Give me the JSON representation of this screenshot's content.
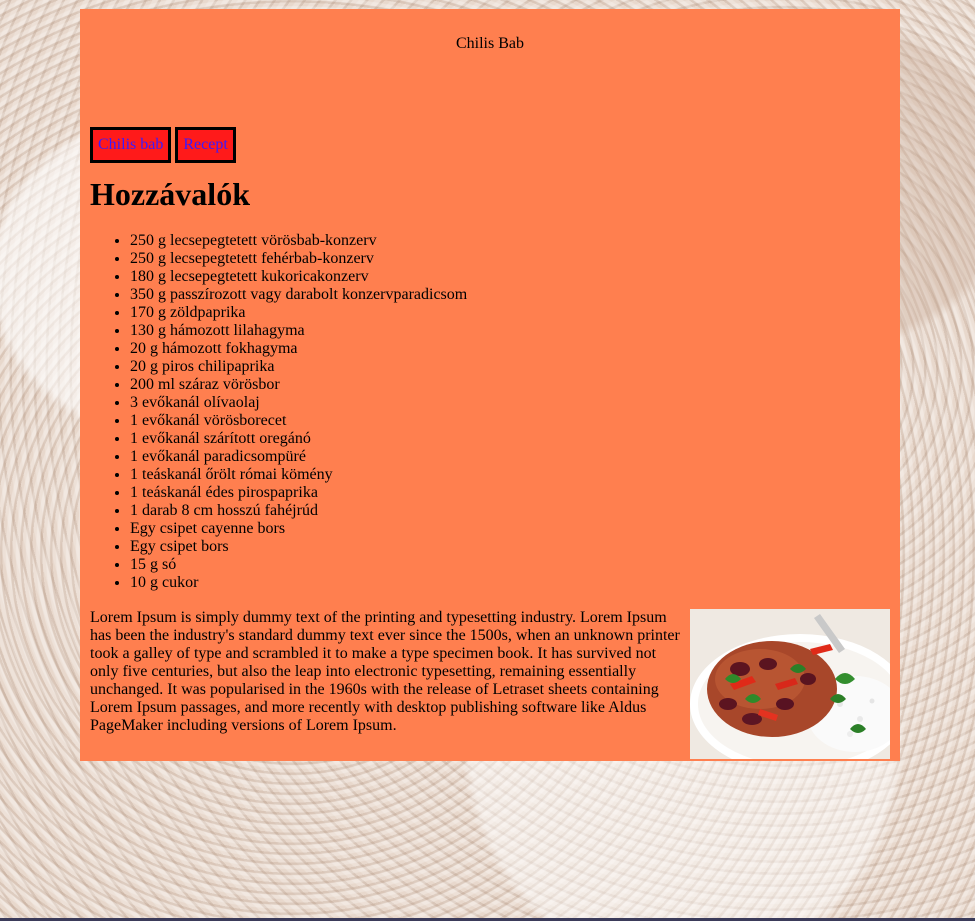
{
  "site": {
    "title": "Chilis Bab"
  },
  "nav": {
    "items": [
      {
        "label": "Chilis bab"
      },
      {
        "label": "Recept"
      }
    ]
  },
  "section": {
    "heading": "Hozzávalók"
  },
  "ingredients": [
    "250 g lecsepegtetett vörösbab-konzerv",
    "250 g lecsepegtetett fehérbab-konzerv",
    "180 g lecsepegtetett kukoricakonzerv",
    "350 g passzírozott vagy darabolt konzervparadicsom",
    "170 g zöldpaprika",
    "130 g hámozott lilahagyma",
    "20 g hámozott fokhagyma",
    "20 g piros chilipaprika",
    "200 ml száraz vörösbor",
    "3 evőkanál olívaolaj",
    "1 evőkanál vörösborecet",
    "1 evőkanál szárított oregánó",
    "1 evőkanál paradicsompüré",
    "1 teáskanál őrölt római kömény",
    "1 teáskanál édes pirospaprika",
    "1 darab 8 cm hosszú fahéjrúd",
    "Egy csipet cayenne bors",
    "Egy csipet bors",
    "15 g só",
    "10 g cukor"
  ],
  "description": "Lorem Ipsum is simply dummy text of the printing and typesetting industry. Lorem Ipsum has been the industry's standard dummy text ever since the 1500s, when an unknown printer took a galley of type and scrambled it to make a type specimen book. It has survived not only five centuries, but also the leap into electronic typesetting, remaining essentially unchanged. It was popularised in the 1960s with the release of Letraset sheets containing Lorem Ipsum passages, and more recently with desktop publishing software like Aldus PageMaker including versions of Lorem Ipsum.",
  "colors": {
    "panel": "#ff7f4f",
    "nav_bg": "#ff1a1a",
    "nav_text": "#3a1aff"
  }
}
